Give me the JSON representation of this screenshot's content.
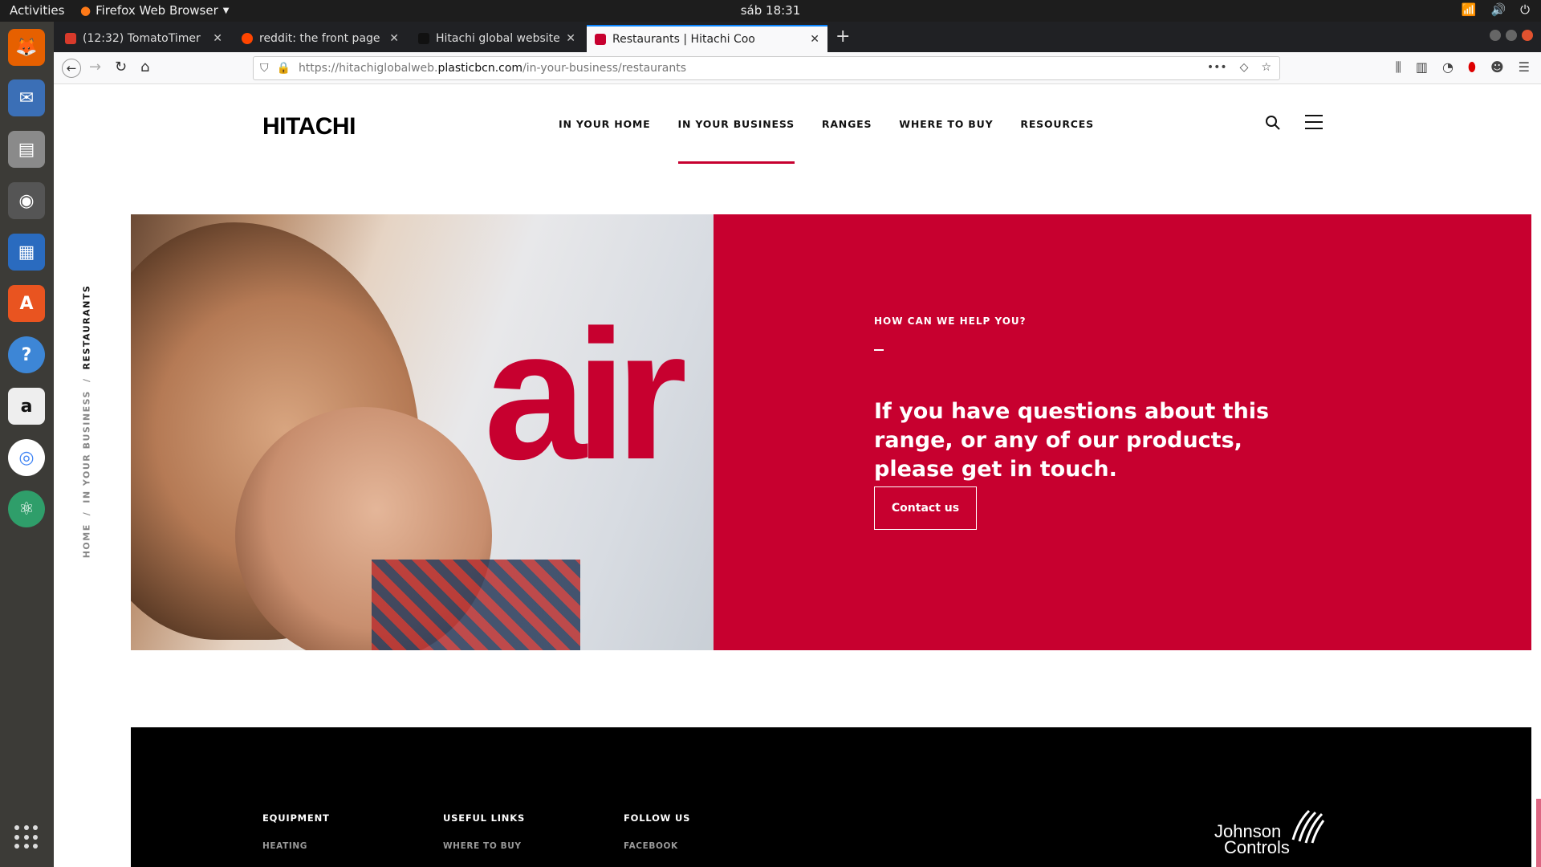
{
  "system": {
    "activities": "Activities",
    "app_name": "Firefox Web Browser",
    "clock": "sáb 18:31"
  },
  "browser": {
    "tabs": [
      {
        "title": "(12:32) TomatoTimer",
        "favicon_color": "#d83a2b"
      },
      {
        "title": "reddit: the front page of",
        "favicon_color": "#ff4500"
      },
      {
        "title": "Hitachi global website / I",
        "favicon_color": "#111111"
      },
      {
        "title": "Restaurants | Hitachi Coo",
        "favicon_color": "#c7002f",
        "active": true
      }
    ],
    "url": {
      "prefix": "https://hitachiglobalweb.",
      "domain": "plasticbcn.com",
      "path": "/in-your-business/restaurants"
    }
  },
  "site": {
    "logo": "HITACHI",
    "nav": [
      "IN YOUR HOME",
      "IN YOUR BUSINESS",
      "RANGES",
      "WHERE TO BUY",
      "RESOURCES"
    ],
    "nav_active": "IN YOUR BUSINESS",
    "breadcrumb": [
      "HOME",
      "/",
      "IN YOUR BUSINESS",
      "/",
      "RESTAURANTS"
    ],
    "hero": {
      "image_word": "air",
      "kicker": "HOW CAN WE HELP YOU?",
      "headline": "If you have questions about this range, or any of our products, please get in touch.",
      "button": "Contact us"
    },
    "footer": {
      "columns": [
        {
          "heading": "EQUIPMENT",
          "first_link": "HEATING"
        },
        {
          "heading": "USEFUL LINKS",
          "first_link": "WHERE TO BUY"
        },
        {
          "heading": "FOLLOW US",
          "first_link": "FACEBOOK"
        }
      ],
      "partner_line1": "Johnson",
      "partner_line2": "Controls"
    },
    "brand_color": "#c7002f"
  }
}
